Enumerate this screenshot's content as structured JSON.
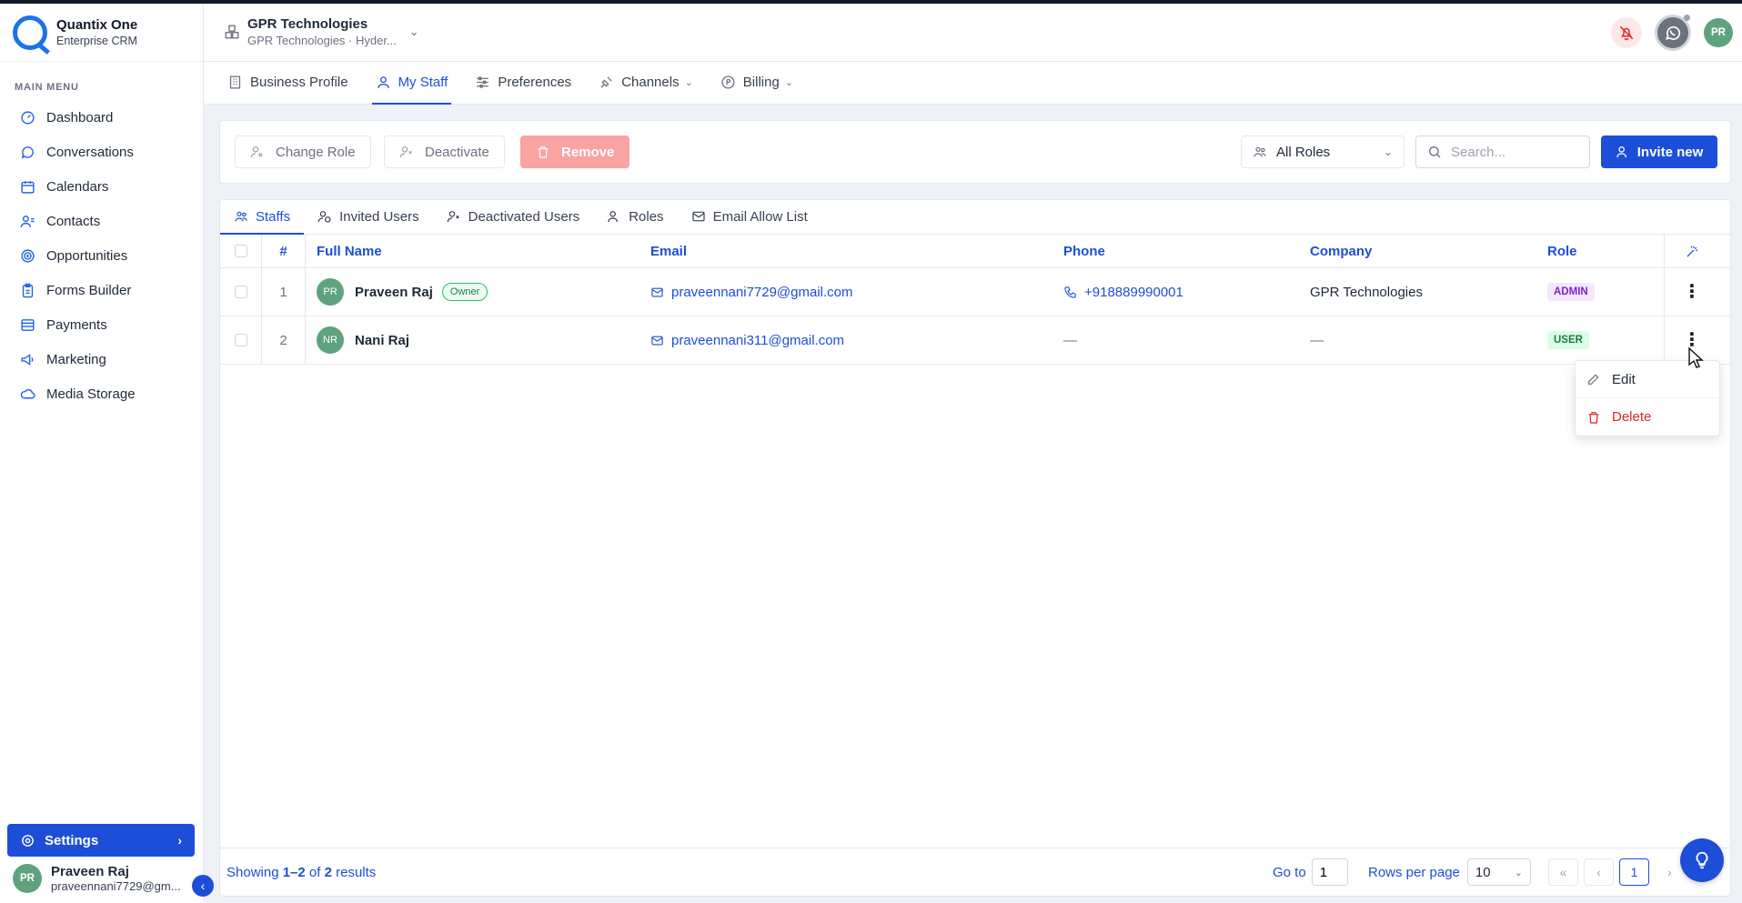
{
  "brand": {
    "name": "Quantix One",
    "subtitle": "Enterprise CRM"
  },
  "sidebar": {
    "menu_title": "MAIN MENU",
    "items": [
      {
        "label": "Dashboard",
        "icon": "dashboard-icon"
      },
      {
        "label": "Conversations",
        "icon": "chat-icon"
      },
      {
        "label": "Calendars",
        "icon": "calendar-icon"
      },
      {
        "label": "Contacts",
        "icon": "contacts-icon"
      },
      {
        "label": "Opportunities",
        "icon": "target-icon"
      },
      {
        "label": "Forms Builder",
        "icon": "clipboard-icon"
      },
      {
        "label": "Payments",
        "icon": "payments-icon"
      },
      {
        "label": "Marketing",
        "icon": "megaphone-icon"
      },
      {
        "label": "Media Storage",
        "icon": "cloud-icon"
      }
    ],
    "settings_label": "Settings",
    "user": {
      "initials": "PR",
      "name": "Praveen Raj",
      "email": "praveennani7729@gm..."
    }
  },
  "header": {
    "org_name": "GPR Technologies",
    "org_sub": "GPR Technologies · Hyder...",
    "avatar_initials": "PR"
  },
  "settings_tabs": [
    {
      "label": "Business Profile"
    },
    {
      "label": "My Staff"
    },
    {
      "label": "Preferences"
    },
    {
      "label": "Channels"
    },
    {
      "label": "Billing"
    }
  ],
  "toolbar": {
    "change_role": "Change Role",
    "deactivate": "Deactivate",
    "remove": "Remove",
    "roles_filter": "All Roles",
    "search_placeholder": "Search...",
    "invite": "Invite new"
  },
  "sub_tabs": [
    {
      "label": "Staffs"
    },
    {
      "label": "Invited Users"
    },
    {
      "label": "Deactivated Users"
    },
    {
      "label": "Roles"
    },
    {
      "label": "Email Allow List"
    }
  ],
  "table": {
    "columns": {
      "num": "#",
      "name": "Full Name",
      "email": "Email",
      "phone": "Phone",
      "company": "Company",
      "role": "Role"
    },
    "rows": [
      {
        "num": "1",
        "initials": "PR",
        "name": "Praveen Raj",
        "badge": "Owner",
        "email": "praveennani7729@gmail.com",
        "phone": "+918889990001",
        "company": "GPR Technologies",
        "role": "ADMIN"
      },
      {
        "num": "2",
        "initials": "NR",
        "name": "Nani Raj",
        "email": "praveennani311@gmail.com",
        "phone": "—",
        "company": "—",
        "role": "USER"
      }
    ]
  },
  "context_menu": {
    "edit": "Edit",
    "delete": "Delete"
  },
  "footer": {
    "showing_prefix": "Showing ",
    "range": "1–2",
    "of": " of ",
    "total": "2",
    "suffix": " results",
    "goto_label": "Go to",
    "goto_value": "1",
    "rpp_label": "Rows per page",
    "rpp_value": "10",
    "current_page": "1"
  },
  "colors": {
    "accent": "#1d4ed8",
    "remove": "#f9a3a3",
    "avatar": "#5fa37e"
  }
}
